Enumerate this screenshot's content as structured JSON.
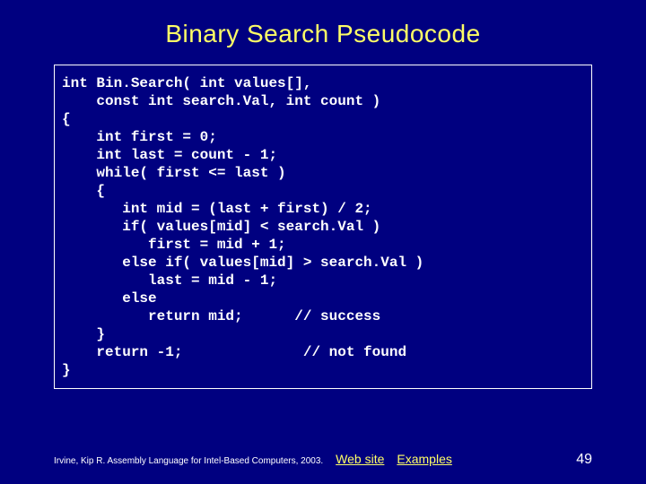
{
  "title": "Binary Search Pseudocode",
  "code": "int Bin.Search( int values[],\n    const int search.Val, int count )\n{\n    int first = 0;\n    int last = count - 1;\n    while( first <= last )\n    {\n       int mid = (last + first) / 2;\n       if( values[mid] < search.Val )\n          first = mid + 1;\n       else if( values[mid] > search.Val )\n          last = mid - 1;\n       else\n          return mid;      // success\n    }\n    return -1;              // not found\n}",
  "footer": {
    "citation": "Irvine, Kip R. Assembly Language for Intel-Based Computers, 2003.",
    "link1": "Web site",
    "link2": "Examples",
    "page": "49"
  }
}
